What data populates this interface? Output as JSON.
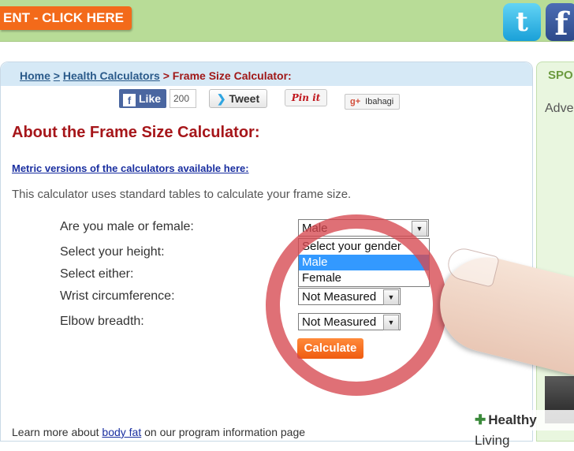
{
  "top": {
    "promo": "ENT - CLICK HERE",
    "twitter_glyph": "t",
    "facebook_glyph": "f"
  },
  "breadcrumb": {
    "home": "Home",
    "sep1": ">",
    "health": "Health Calculators",
    "sep2": ">",
    "current": "Frame Size Calculator:"
  },
  "share": {
    "like": "Like",
    "like_count": "200",
    "tweet": "Tweet",
    "pin": "Pin it",
    "gplus": "Ibahagi"
  },
  "page": {
    "title": "About the Frame Size Calculator:",
    "metric_link": "Metric versions of the calculators available here:",
    "intro": "This calculator uses standard tables to calculate your frame size."
  },
  "form": {
    "gender_label": "Are you male or female:",
    "height_label": "Select your height:",
    "either_label": "Select either:",
    "wrist_label": "Wrist circumference:",
    "elbow_label": "Elbow breadth:",
    "gender_value": "Male",
    "gender_options": [
      "Select your gender",
      "Male",
      "Female"
    ],
    "wrist_value": "Not Measured",
    "elbow_value": "Not Measured",
    "calculate": "Calculate"
  },
  "footer": {
    "learn_pre": "Learn more about ",
    "learn_link": "body fat",
    "learn_post": " on our program information page"
  },
  "sidebar": {
    "sponsored": "SPO",
    "adv": "Adve"
  },
  "watermark": {
    "brand1": "Healthy",
    "brand2": " Living"
  },
  "colors": {
    "accent": "#f36a1a",
    "heading": "#a6161a",
    "highlight": "#3399ff",
    "ring": "#d64850"
  },
  "icons": {
    "twitter": "twitter-icon",
    "facebook": "facebook-icon",
    "dropdown": "chevron-down-icon"
  }
}
